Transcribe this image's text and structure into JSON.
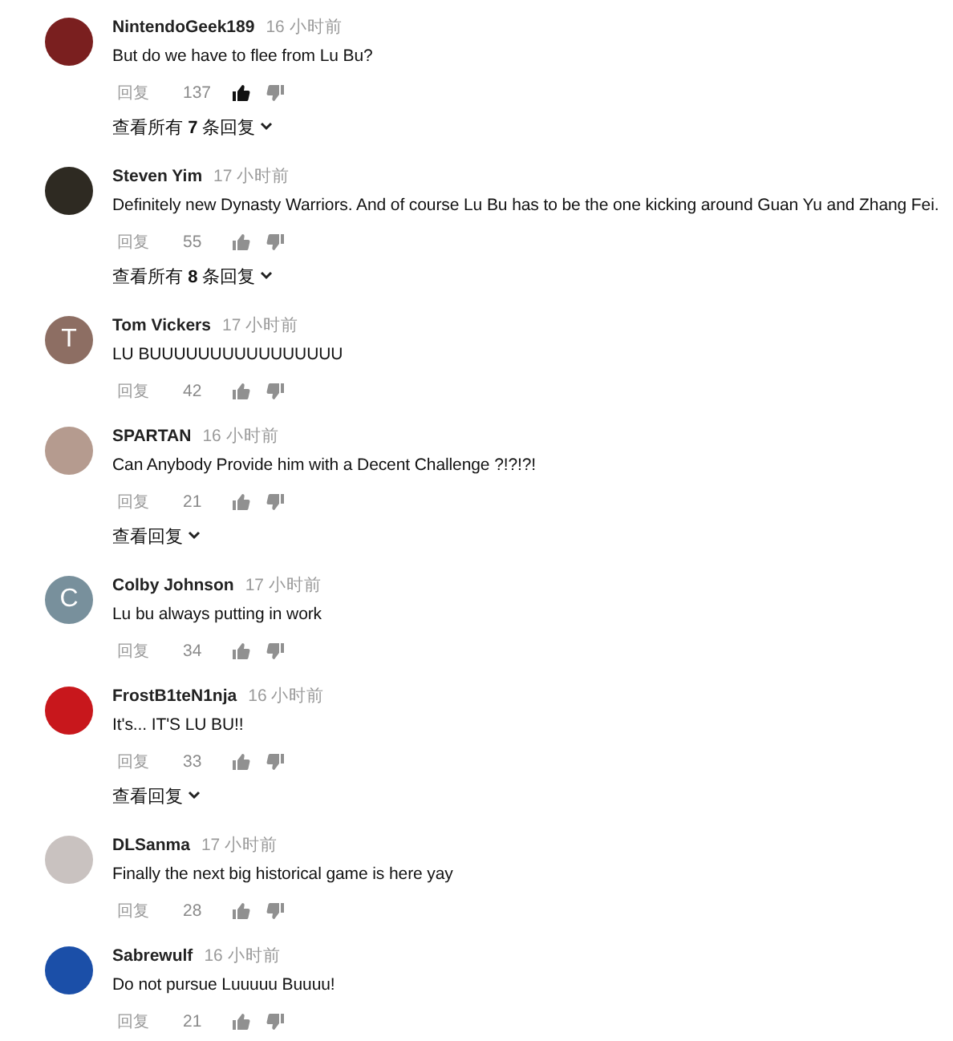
{
  "comments": [
    {
      "author": "NintendoGeek189",
      "time": "16 小时前",
      "text": "But do we have to flee from Lu Bu?",
      "reply_label": "回复",
      "likes": "137",
      "liked": true,
      "avatar": {
        "kind": "image",
        "color": "#7a1f1f"
      },
      "replies_link": "查看所有 **7** 条回复"
    },
    {
      "author": "Steven Yim",
      "time": "17 小时前",
      "text": "Definitely new Dynasty Warriors. And of course Lu Bu has to be the one kicking around Guan Yu and Zhang Fei.",
      "reply_label": "回复",
      "likes": "55",
      "liked": false,
      "avatar": {
        "kind": "image",
        "color": "#2e2a22"
      },
      "replies_link": "查看所有 **8** 条回复"
    },
    {
      "author": "Tom Vickers",
      "time": "17 小时前",
      "text": "LU BUUUUUUUUUUUUUUUU",
      "reply_label": "回复",
      "likes": "42",
      "liked": false,
      "avatar": {
        "kind": "letter",
        "letter": "T",
        "color": "#8d6e63"
      }
    },
    {
      "author": "SPARTAN",
      "time": "16 小时前",
      "text": "Can Anybody Provide him with a Decent Challenge ?!?!?!",
      "reply_label": "回复",
      "likes": "21",
      "liked": false,
      "avatar": {
        "kind": "image",
        "color": "#b59b8f"
      },
      "replies_link": "查看回复"
    },
    {
      "author": "Colby Johnson",
      "time": "17 小时前",
      "text": "Lu bu always putting in work",
      "reply_label": "回复",
      "likes": "34",
      "liked": false,
      "avatar": {
        "kind": "letter",
        "letter": "C",
        "color": "#78909c"
      }
    },
    {
      "author": "FrostB1teN1nja",
      "time": "16 小时前",
      "text": "It's... IT'S LU BU!!",
      "reply_label": "回复",
      "likes": "33",
      "liked": false,
      "avatar": {
        "kind": "image",
        "color": "#c8171c"
      },
      "replies_link": "查看回复"
    },
    {
      "author": "DLSanma",
      "time": "17 小时前",
      "text": "Finally the next big historical game is here yay",
      "reply_label": "回复",
      "likes": "28",
      "liked": false,
      "avatar": {
        "kind": "image",
        "color": "#c9c2c0"
      }
    },
    {
      "author": "Sabrewulf",
      "time": "16 小时前",
      "text": "Do not pursue Luuuuu Buuuu!",
      "reply_label": "回复",
      "likes": "21",
      "liked": false,
      "avatar": {
        "kind": "image",
        "color": "#1b4fa8"
      }
    }
  ]
}
